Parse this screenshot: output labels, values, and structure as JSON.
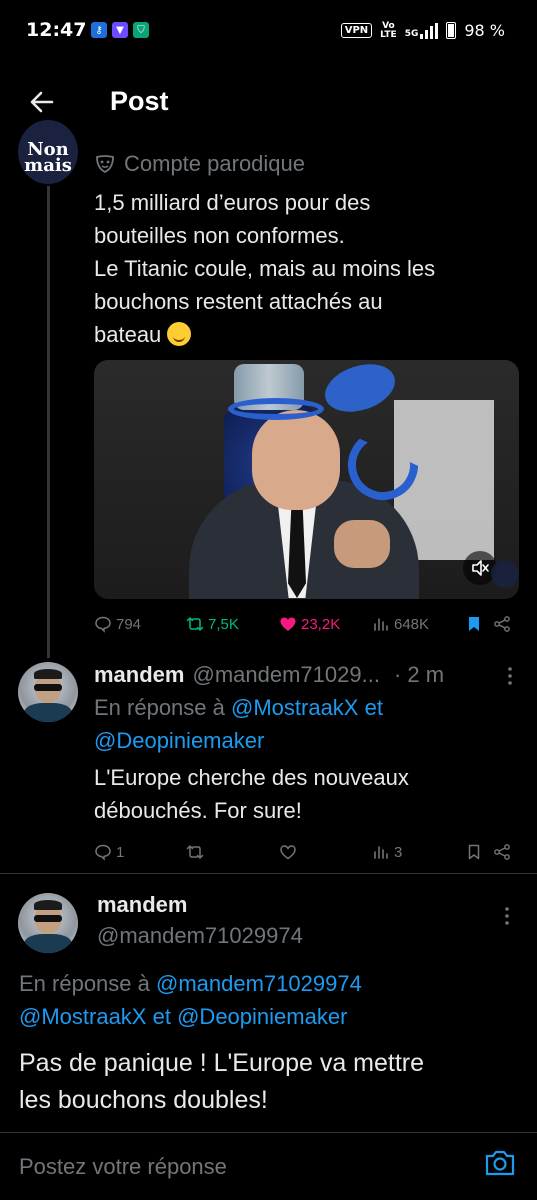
{
  "status_bar": {
    "time": "12:47",
    "apps": [
      "key-app-icon",
      "vpn-app-icon",
      "shield-app-icon"
    ],
    "vpn_label": "VPN",
    "volte_top": "Vo",
    "volte_bottom": "LTE",
    "network": "5G",
    "battery": "98 %"
  },
  "header": {
    "title": "Post"
  },
  "parent_post": {
    "avatar_text": "Non mais",
    "parody_label": "Compte parodique",
    "text_lines": [
      "1,5 milliard d’euros pour des",
      "bouteilles non conformes.",
      "Le Titanic coule, mais au moins les",
      "bouchons restent attachés au",
      "bateau"
    ],
    "actions": {
      "replies": "794",
      "reposts": "7,5K",
      "likes": "23,2K",
      "views": "648K"
    }
  },
  "reply_1": {
    "name": "mandem",
    "handle": "@mandem71029...",
    "time": "· 2 m",
    "reply_to_prefix": "En réponse à",
    "mention_1": "@MostraakX",
    "reply_to_and": "et",
    "mention_2": "@Deopiniemaker",
    "text_lines": [
      "L'Europe cherche des nouveaux",
      "débouchés. For sure!"
    ],
    "actions": {
      "replies": "1",
      "views": "3"
    }
  },
  "focused_reply": {
    "name": "mandem",
    "handle": "@mandem71029974",
    "reply_to_prefix": "En réponse à",
    "mention_1": "@mandem71029974",
    "mention_2": "@MostraakX",
    "reply_to_and": "et",
    "mention_3": "@Deopiniemaker",
    "text_lines": [
      "Pas de panique ! L'Europe va mettre",
      "les bouchons doubles!"
    ]
  },
  "compose": {
    "placeholder": "Postez votre réponse"
  },
  "colors": {
    "accent": "#1d9bf0",
    "like": "#f91880",
    "repost": "#00ba7c",
    "muted": "#71767b"
  }
}
